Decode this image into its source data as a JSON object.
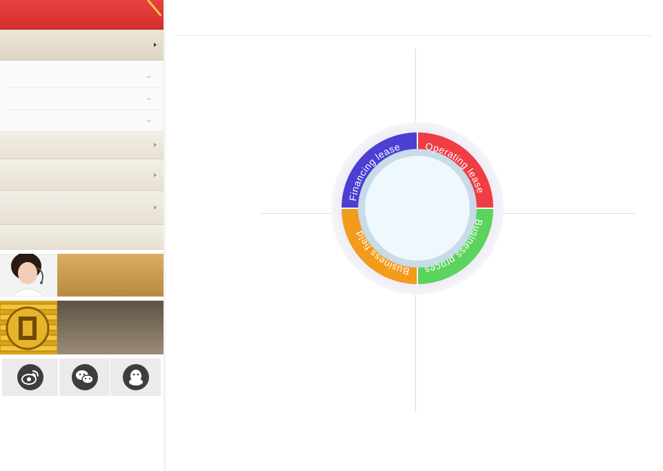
{
  "sidebar": {
    "header": {
      "title": ""
    },
    "menu": [
      {
        "label": "",
        "active": true
      },
      {
        "label": ""
      },
      {
        "label": ""
      },
      {
        "label": ""
      },
      {
        "label": ""
      }
    ],
    "submenu": [
      {
        "label": ""
      },
      {
        "label": ""
      },
      {
        "label": ""
      }
    ],
    "banners": [
      {
        "text": "",
        "color": "#c99a4e"
      },
      {
        "text": "",
        "color": "#7a6a55"
      }
    ],
    "social": [
      {
        "icon": "weibo-icon"
      },
      {
        "icon": "wechat-icon"
      },
      {
        "icon": "qq-icon"
      }
    ]
  },
  "main": {
    "title": ""
  },
  "diagram": {
    "segments": [
      {
        "label": "Operating lease",
        "color": "#ef3d44"
      },
      {
        "label": "Business process",
        "color": "#5bd35c"
      },
      {
        "label": "Business field",
        "color": "#f39b1b"
      },
      {
        "label": "Financing lease",
        "color": "#4b3fd4"
      }
    ],
    "center_text": ""
  },
  "colors": {
    "brand": "#d62e2c",
    "sidebar_bg": "#efeadd"
  }
}
